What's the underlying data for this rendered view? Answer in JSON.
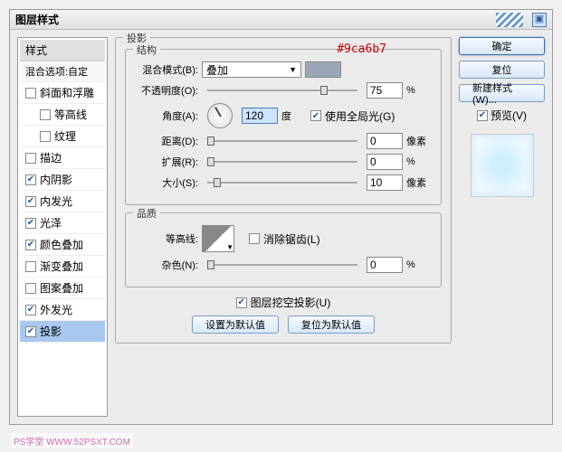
{
  "window": {
    "title": "图层样式"
  },
  "sidebar": {
    "header": "样式",
    "blend_sub": "混合选项:自定",
    "items": [
      {
        "label": "斜面和浮雕",
        "checked": false,
        "indent": false
      },
      {
        "label": "等高线",
        "checked": false,
        "indent": true
      },
      {
        "label": "纹理",
        "checked": false,
        "indent": true
      },
      {
        "label": "描边",
        "checked": false,
        "indent": false
      },
      {
        "label": "内阴影",
        "checked": true,
        "indent": false
      },
      {
        "label": "内发光",
        "checked": true,
        "indent": false
      },
      {
        "label": "光泽",
        "checked": true,
        "indent": false
      },
      {
        "label": "颜色叠加",
        "checked": true,
        "indent": false
      },
      {
        "label": "渐变叠加",
        "checked": false,
        "indent": false
      },
      {
        "label": "图案叠加",
        "checked": false,
        "indent": false
      },
      {
        "label": "外发光",
        "checked": true,
        "indent": false
      },
      {
        "label": "投影",
        "checked": true,
        "indent": false,
        "selected": true
      }
    ]
  },
  "panel": {
    "title": "投影",
    "group_structure": "结构",
    "group_quality": "品质",
    "blend_mode_label": "混合模式(B):",
    "blend_mode_value": "叠加",
    "color_hex": "#9ca6b7",
    "opacity_label": "不透明度(O):",
    "opacity_value": "75",
    "opacity_unit": "%",
    "angle_label": "角度(A):",
    "angle_value": "120",
    "angle_unit": "度",
    "global_light": "使用全局光(G)",
    "distance_label": "距离(D):",
    "distance_value": "0",
    "distance_unit": "像素",
    "spread_label": "扩展(R):",
    "spread_value": "0",
    "spread_unit": "%",
    "size_label": "大小(S):",
    "size_value": "10",
    "size_unit": "像素",
    "contour_label": "等高线:",
    "antialias": "消除锯齿(L)",
    "noise_label": "杂色(N):",
    "noise_value": "0",
    "noise_unit": "%",
    "knockout": "图层挖空投影(U)",
    "btn_default": "设置为默认值",
    "btn_reset": "复位为默认值"
  },
  "buttons": {
    "ok": "确定",
    "cancel": "复位",
    "new_style": "新建样式(W)...",
    "preview": "预览(V)"
  },
  "watermark": "PS学堂 WWW.52PSXT.COM"
}
